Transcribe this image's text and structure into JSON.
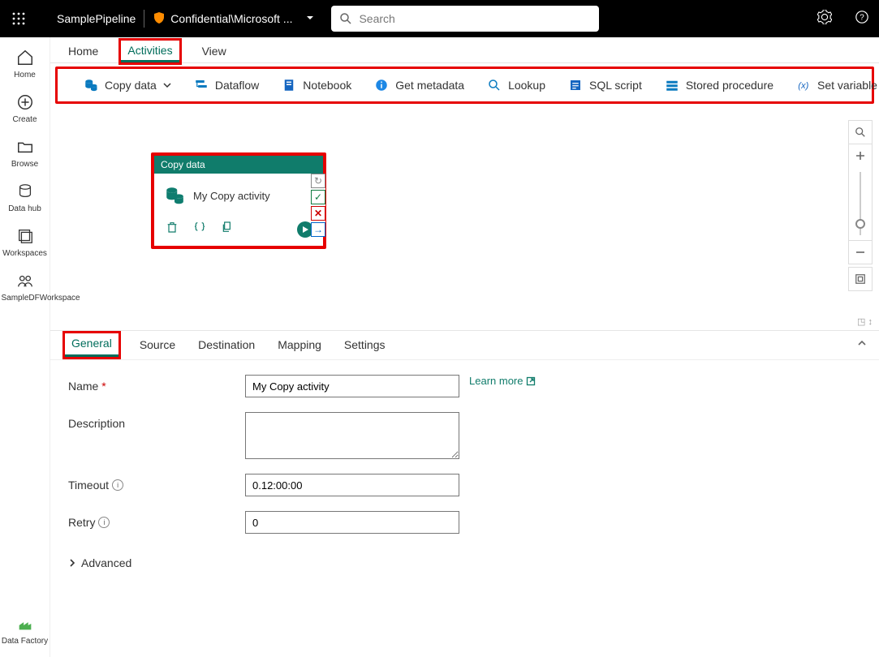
{
  "header": {
    "pipeline_name": "SamplePipeline",
    "sensitivity_label": "Confidential\\Microsoft ...",
    "search_placeholder": "Search"
  },
  "leftnav": {
    "items": [
      {
        "label": "Home"
      },
      {
        "label": "Create"
      },
      {
        "label": "Browse"
      },
      {
        "label": "Data hub"
      },
      {
        "label": "Workspaces"
      },
      {
        "label": "SampleDFWorkspace"
      }
    ],
    "footer": "Data Factory"
  },
  "main_tabs": [
    "Home",
    "Activities",
    "View"
  ],
  "main_tab_active": "Activities",
  "ribbon": {
    "items": [
      "Copy data",
      "Dataflow",
      "Notebook",
      "Get metadata",
      "Lookup",
      "SQL script",
      "Stored procedure",
      "Set variable"
    ]
  },
  "canvas": {
    "node": {
      "type_title": "Copy data",
      "name": "My Copy activity"
    }
  },
  "prop_tabs": [
    "General",
    "Source",
    "Destination",
    "Mapping",
    "Settings"
  ],
  "prop_tab_active": "General",
  "form": {
    "labels": {
      "name": "Name",
      "description": "Description",
      "timeout": "Timeout",
      "retry": "Retry",
      "advanced": "Advanced",
      "learn_more": "Learn more"
    },
    "values": {
      "name": "My Copy activity",
      "description": "",
      "timeout": "0.12:00:00",
      "retry": "0"
    }
  }
}
